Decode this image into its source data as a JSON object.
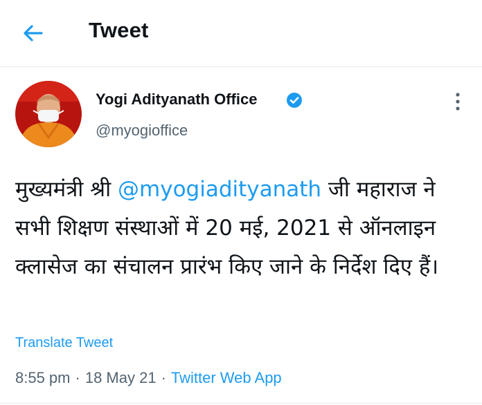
{
  "header": {
    "title": "Tweet",
    "back_icon": "arrow-left-icon"
  },
  "tweet": {
    "author_name": "Yogi Adityanath Office",
    "verified_icon": "verified-badge-icon",
    "handle": "@myogioffice",
    "more_icon": "more-vertical-icon",
    "text_before_mention": "मुख्यमंत्री श्री ",
    "mention": "@myogiadityanath",
    "text_after_mention": " जी महाराज ने सभी शिक्षण संस्थाओं में 20 मई, 2021 से ऑनलाइन क्लासेज का संचालन प्रारंभ किए जाने के निर्देश दिए हैं।",
    "translate_label": "Translate Tweet",
    "time": "8:55 pm",
    "separator": "·",
    "date": "18 May 21",
    "source": "Twitter Web App"
  },
  "colors": {
    "accent": "#1d9bf0",
    "secondary_text": "#536471",
    "text": "#0f1419",
    "divider": "#e6ecf0"
  }
}
